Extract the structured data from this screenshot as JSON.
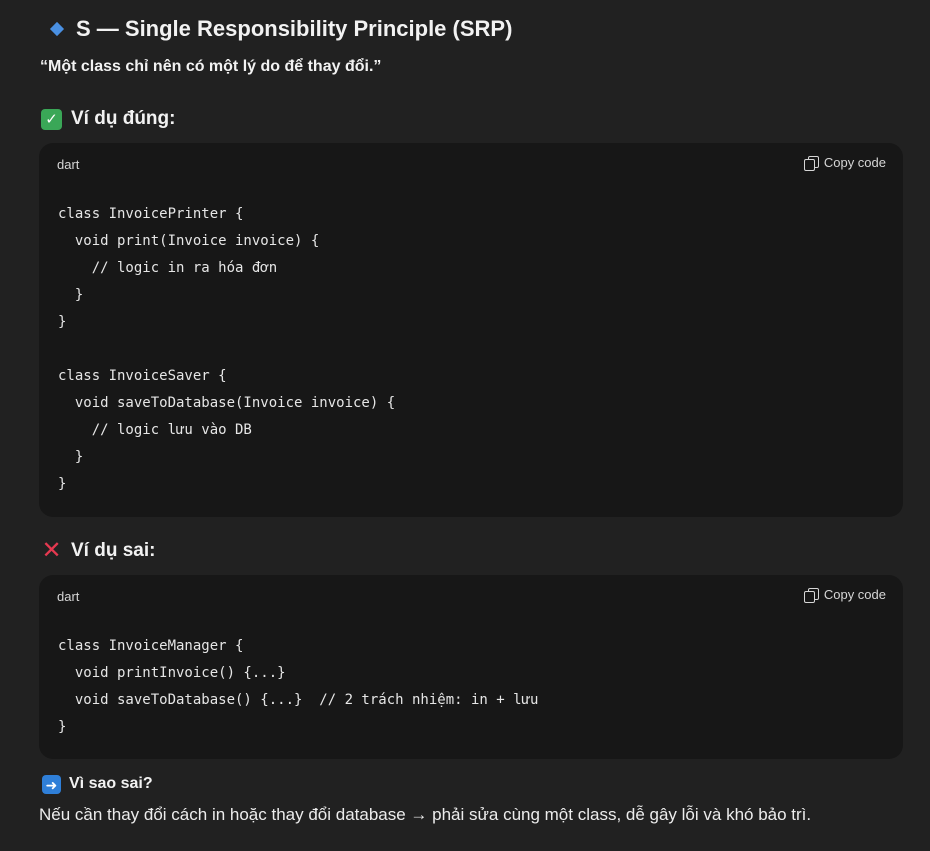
{
  "heading": {
    "icon": "blue-diamond-icon",
    "title": "S — Single Responsibility Principle (SRP)"
  },
  "quote": "“Một class chỉ nên có một lý do để thay đổi.”",
  "good_example": {
    "icon": "check-mark-icon",
    "label": "Ví dụ đúng:",
    "code_lang": "dart",
    "copy_label": "Copy code",
    "code": "class InvoicePrinter {\n  void print(Invoice invoice) {\n    // logic in ra hóa đơn\n  }\n}\n\nclass InvoiceSaver {\n  void saveToDatabase(Invoice invoice) {\n    // logic lưu vào DB\n  }\n}"
  },
  "bad_example": {
    "icon": "cross-mark-icon",
    "label": "Ví dụ sai:",
    "code_lang": "dart",
    "copy_label": "Copy code",
    "code": "class InvoiceManager {\n  void printInvoice() {...}\n  void saveToDatabase() {...}  // 2 trách nhiệm: in + lưu\n}"
  },
  "why": {
    "icon": "right-arrow-icon",
    "label": "Vì sao sai?",
    "text": "Nếu cần thay đổi cách in hoặc thay đổi database → phải sửa cùng một class, dễ gây lỗi và khó bảo trì."
  },
  "colors": {
    "background": "#212121",
    "code_background": "#171717",
    "accent_blue": "#4a90e2",
    "check_green": "#3aa757",
    "cross_red": "#e53950"
  }
}
